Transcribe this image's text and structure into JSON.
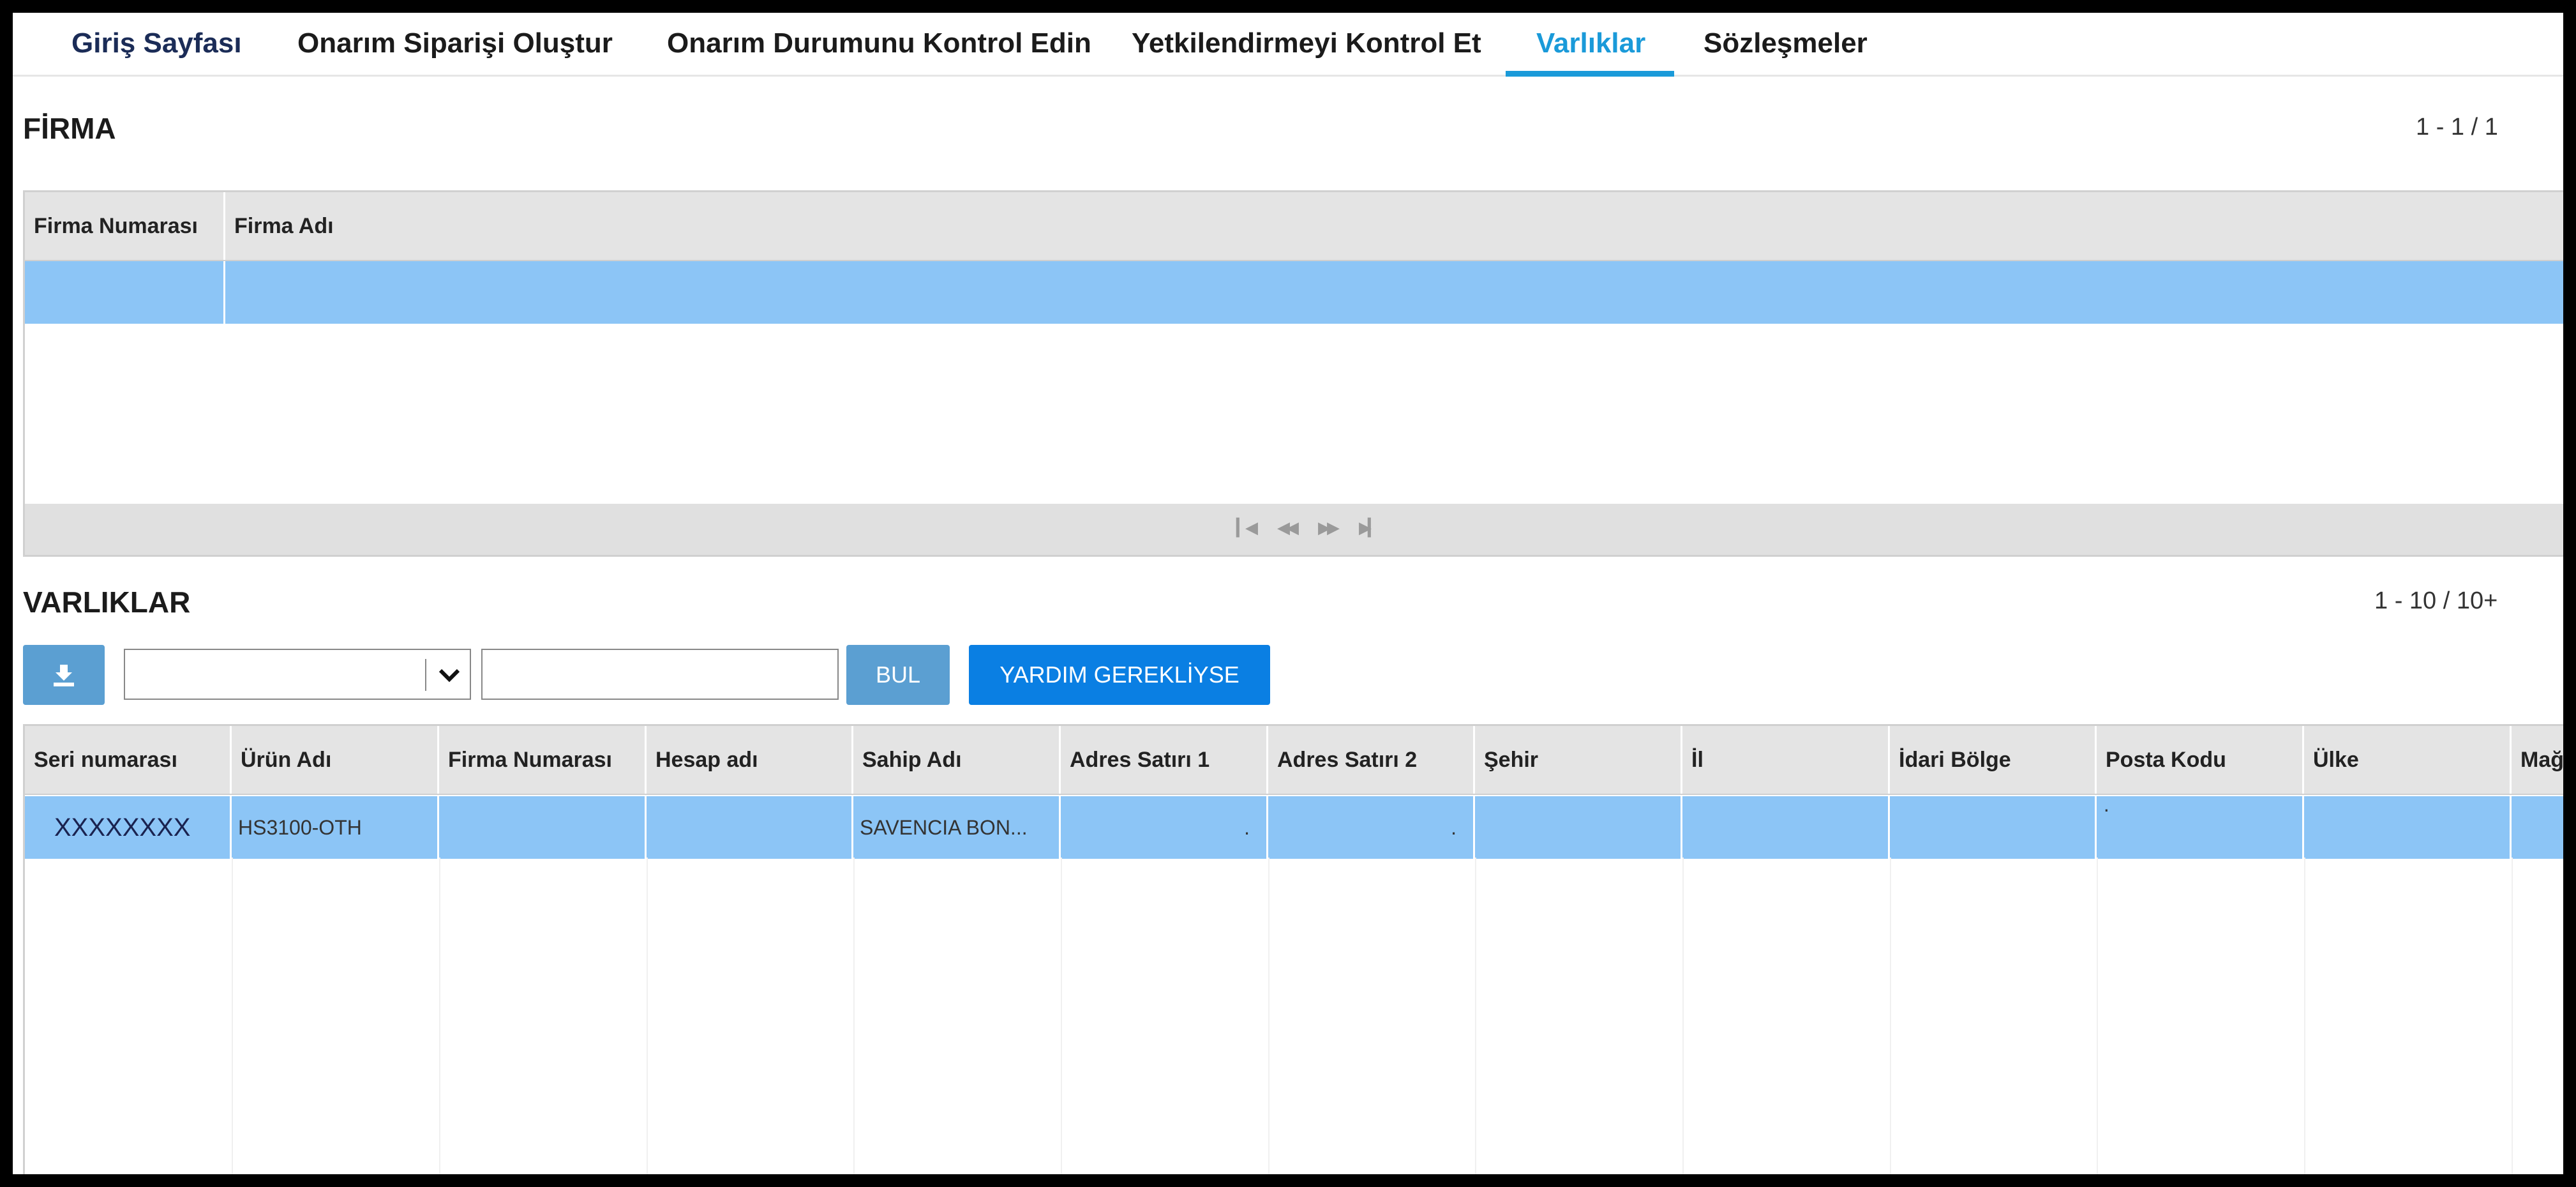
{
  "nav": {
    "tabs": [
      {
        "label": "Giriş Sayfası"
      },
      {
        "label": "Onarım Siparişi Oluştur"
      },
      {
        "label": "Onarım Durumunu Kontrol Edin"
      },
      {
        "label": "Yetkilendirmeyi Kontrol Et"
      },
      {
        "label": "Varlıklar",
        "active": true
      },
      {
        "label": "Sözleşmeler"
      }
    ]
  },
  "firma": {
    "title": "FİRMA",
    "pager": "1 - 1 / 1",
    "columns": [
      "Firma Numarası",
      "Firma Adı"
    ],
    "rows": [
      [
        "",
        ""
      ]
    ],
    "footer_icons": [
      "first-page-icon",
      "prev-page-icon",
      "next-page-icon",
      "last-page-icon"
    ]
  },
  "assets": {
    "title": "VARLIKLAR",
    "pager": "1 - 10 / 10+",
    "toolbar": {
      "download_icon": "download-icon",
      "select_value": "",
      "search_value": "",
      "find_label": "BUL",
      "help_label": "YARDIM GEREKLİYSE"
    },
    "columns": [
      "Seri numarası",
      "Ürün Adı",
      "Firma Numarası",
      "Hesap adı",
      "Sahip Adı",
      "Adres Satırı 1",
      "Adres Satırı 2",
      "Şehir",
      "İl",
      "İdari Bölge",
      "Posta Kodu",
      "Ülke",
      "Mağ"
    ],
    "rows": [
      [
        "XXXXXXXX",
        "HS3100-OTH",
        "",
        "",
        "SAVENCIA BON...",
        ".",
        ".",
        "",
        "",
        "",
        "·",
        "",
        ""
      ]
    ]
  },
  "colors": {
    "accent": "#1a9ad9",
    "selected_row": "#8cc5f6",
    "button": "#5b9fd2",
    "primary_button": "#0a7fe3"
  }
}
